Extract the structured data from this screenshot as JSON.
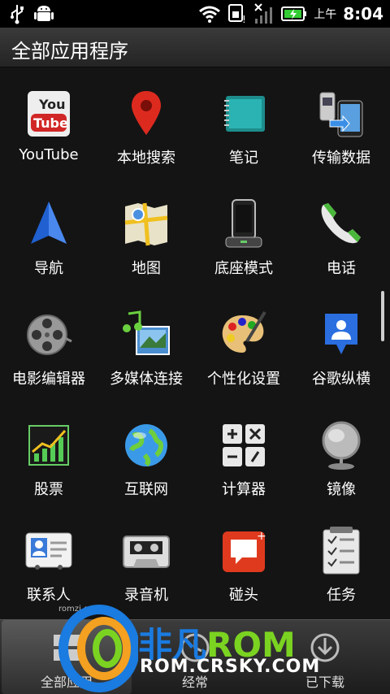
{
  "status": {
    "ampm": "上午",
    "time": "8:04"
  },
  "header": {
    "title": "全部应用程序"
  },
  "apps": [
    {
      "label": "YouTube",
      "icon": "youtube-icon"
    },
    {
      "label": "本地搜索",
      "icon": "map-pin-icon"
    },
    {
      "label": "笔记",
      "icon": "notebook-icon"
    },
    {
      "label": "传输数据",
      "icon": "transfer-phone-icon"
    },
    {
      "label": "导航",
      "icon": "navigation-arrow-icon"
    },
    {
      "label": "地图",
      "icon": "map-icon"
    },
    {
      "label": "底座模式",
      "icon": "dock-phone-icon"
    },
    {
      "label": "电话",
      "icon": "phone-handset-icon"
    },
    {
      "label": "电影编辑器",
      "icon": "film-reel-icon"
    },
    {
      "label": "多媒体连接",
      "icon": "media-link-icon"
    },
    {
      "label": "个性化设置",
      "icon": "palette-icon"
    },
    {
      "label": "谷歌纵横",
      "icon": "latitude-icon"
    },
    {
      "label": "股票",
      "icon": "stock-chart-icon"
    },
    {
      "label": "互联网",
      "icon": "globe-icon"
    },
    {
      "label": "计算器",
      "icon": "calculator-icon"
    },
    {
      "label": "镜像",
      "icon": "mirror-icon"
    },
    {
      "label": "联系人",
      "icon": "contact-card-icon"
    },
    {
      "label": "录音机",
      "icon": "cassette-icon"
    },
    {
      "label": "碰头",
      "icon": "speech-bubble-icon"
    },
    {
      "label": "任务",
      "icon": "checklist-icon"
    }
  ],
  "tabs": [
    {
      "label": "全部应用",
      "icon": "grid-icon",
      "active": true
    },
    {
      "label": "经常",
      "icon": "clock-icon"
    },
    {
      "label": "已下载",
      "icon": "download-icon"
    }
  ],
  "watermark": {
    "brand_cn": "非凡",
    "brand_rom": "ROM",
    "url": "ROM.CRSKY.COM",
    "small": "romzj.com"
  },
  "colors": {
    "background": "#141414",
    "header": "#2e2e2e",
    "watermark_green": "#7bd321",
    "watermark_blue": "#1a7be0"
  }
}
